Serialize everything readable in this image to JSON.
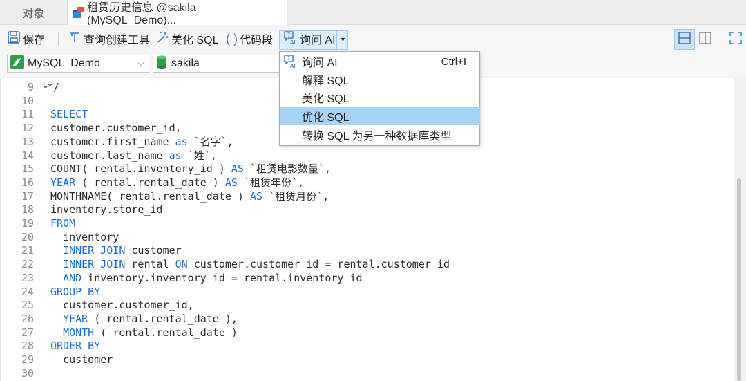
{
  "tabs": [
    {
      "label": "对象"
    },
    {
      "label": "租赁历史信息 @sakila (MySQL_Demo)..."
    }
  ],
  "toolbar": {
    "save": "保存",
    "query_builder": "查询创建工具",
    "beautify": "美化 SQL",
    "snippet": "代码段",
    "ask_ai": "询问 AI"
  },
  "connection": {
    "name": "MySQL_Demo"
  },
  "database": {
    "name": "sakila"
  },
  "ai_menu": {
    "items": [
      {
        "label": "询问 AI",
        "shortcut": "Ctrl+I"
      },
      {
        "label": "解释 SQL",
        "shortcut": ""
      },
      {
        "label": "美化 SQL",
        "shortcut": ""
      },
      {
        "label": "优化 SQL",
        "shortcut": ""
      },
      {
        "label": "转换 SQL 为另一种数据库类型",
        "shortcut": ""
      }
    ],
    "highlighted_index": 3
  },
  "editor": {
    "lines": [
      {
        "n": "9",
        "segments": [
          {
            "t": "└*/",
            "c": "plain"
          }
        ]
      },
      {
        "n": "10",
        "segments": []
      },
      {
        "n": "11",
        "segments": [
          {
            "t": "SELECT",
            "c": "kw"
          }
        ]
      },
      {
        "n": "12",
        "segments": [
          {
            "t": "customer.customer_id,",
            "c": "plain"
          }
        ]
      },
      {
        "n": "13",
        "segments": [
          {
            "t": "customer.first_name ",
            "c": "plain"
          },
          {
            "t": "as",
            "c": "kw"
          },
          {
            "t": " `名字`,",
            "c": "plain"
          }
        ]
      },
      {
        "n": "14",
        "segments": [
          {
            "t": "customer.last_name ",
            "c": "plain"
          },
          {
            "t": "as",
            "c": "kw"
          },
          {
            "t": " `姓`,",
            "c": "plain"
          }
        ]
      },
      {
        "n": "15",
        "segments": [
          {
            "t": "COUNT( rental.inventory_id ) ",
            "c": "plain"
          },
          {
            "t": "AS",
            "c": "kw"
          },
          {
            "t": " `租赁电影数量`,",
            "c": "plain"
          }
        ]
      },
      {
        "n": "16",
        "segments": [
          {
            "t": "YEAR",
            "c": "kw"
          },
          {
            "t": " ( rental.rental_date ) ",
            "c": "plain"
          },
          {
            "t": "AS",
            "c": "kw"
          },
          {
            "t": " `租赁年份`,",
            "c": "plain"
          }
        ]
      },
      {
        "n": "17",
        "segments": [
          {
            "t": "MONTHNAME( rental.rental_date ) ",
            "c": "plain"
          },
          {
            "t": "AS",
            "c": "kw"
          },
          {
            "t": " `租赁月份`,",
            "c": "plain"
          }
        ]
      },
      {
        "n": "18",
        "segments": [
          {
            "t": "inventory.store_id",
            "c": "plain"
          }
        ]
      },
      {
        "n": "19",
        "segments": [
          {
            "t": "FROM",
            "c": "kw"
          }
        ]
      },
      {
        "n": "20",
        "segments": [
          {
            "t": "  inventory",
            "c": "plain"
          }
        ]
      },
      {
        "n": "21",
        "segments": [
          {
            "t": "  ",
            "c": "plain"
          },
          {
            "t": "INNER JOIN",
            "c": "kw"
          },
          {
            "t": " customer",
            "c": "plain"
          }
        ]
      },
      {
        "n": "22",
        "segments": [
          {
            "t": "  ",
            "c": "plain"
          },
          {
            "t": "INNER JOIN",
            "c": "kw"
          },
          {
            "t": " rental ",
            "c": "plain"
          },
          {
            "t": "ON",
            "c": "kw"
          },
          {
            "t": " customer.customer_id = rental.customer_id",
            "c": "plain"
          }
        ]
      },
      {
        "n": "23",
        "segments": [
          {
            "t": "  ",
            "c": "plain"
          },
          {
            "t": "AND",
            "c": "kw"
          },
          {
            "t": " inventory.inventory_id = rental.inventory_id",
            "c": "plain"
          }
        ]
      },
      {
        "n": "24",
        "segments": [
          {
            "t": "GROUP BY",
            "c": "kw"
          }
        ]
      },
      {
        "n": "25",
        "segments": [
          {
            "t": "  customer.customer_id,",
            "c": "plain"
          }
        ]
      },
      {
        "n": "26",
        "segments": [
          {
            "t": "  ",
            "c": "plain"
          },
          {
            "t": "YEAR",
            "c": "kw"
          },
          {
            "t": " ( rental.rental_date ),",
            "c": "plain"
          }
        ]
      },
      {
        "n": "27",
        "segments": [
          {
            "t": "  ",
            "c": "plain"
          },
          {
            "t": "MONTH",
            "c": "kw"
          },
          {
            "t": " ( rental.rental_date )",
            "c": "plain"
          }
        ]
      },
      {
        "n": "28",
        "segments": [
          {
            "t": "ORDER BY",
            "c": "kw"
          }
        ]
      },
      {
        "n": "29",
        "segments": [
          {
            "t": "  customer",
            "c": "plain"
          }
        ]
      },
      {
        "n": "30",
        "segments": []
      }
    ]
  },
  "colors": {
    "keyword": "#1e6fc7",
    "menu_highlight": "#a9d3f5",
    "accent": "#2e8ad8"
  }
}
